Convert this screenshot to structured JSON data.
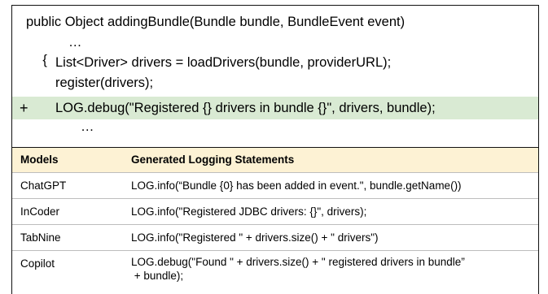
{
  "code": {
    "signature": "public Object addingBundle(Bundle bundle, BundleEvent event)",
    "open_brace": "{",
    "ellipsis_1": "…",
    "list_line": "List<Driver> drivers = loadDrivers(bundle, providerURL);",
    "register_line": "register(drivers);",
    "added_marker": "+",
    "added_line": "LOG.debug(\"Registered {} drivers in bundle {}\", drivers, bundle);",
    "ellipsis_2": "…",
    "added_highlight_color": "#d9ead3"
  },
  "table": {
    "header_color": "#fdf2d4",
    "headers": [
      "Models",
      "Generated Logging Statements"
    ],
    "rows": [
      {
        "model": "ChatGPT",
        "statement": "LOG.info(“Bundle {0} has been added in event.\", bundle.getName())"
      },
      {
        "model": "InCoder",
        "statement": "LOG.info(\"Registered JDBC drivers: {}\", drivers);"
      },
      {
        "model": "TabNine",
        "statement": "LOG.info(\"Registered \" + drivers.size() + \" drivers\")"
      },
      {
        "model": "Copilot",
        "statement_line1": "LOG.debug(\"Found \" + drivers.size() + \" registered drivers in bundle”",
        "statement_line2": " + bundle);"
      }
    ]
  }
}
